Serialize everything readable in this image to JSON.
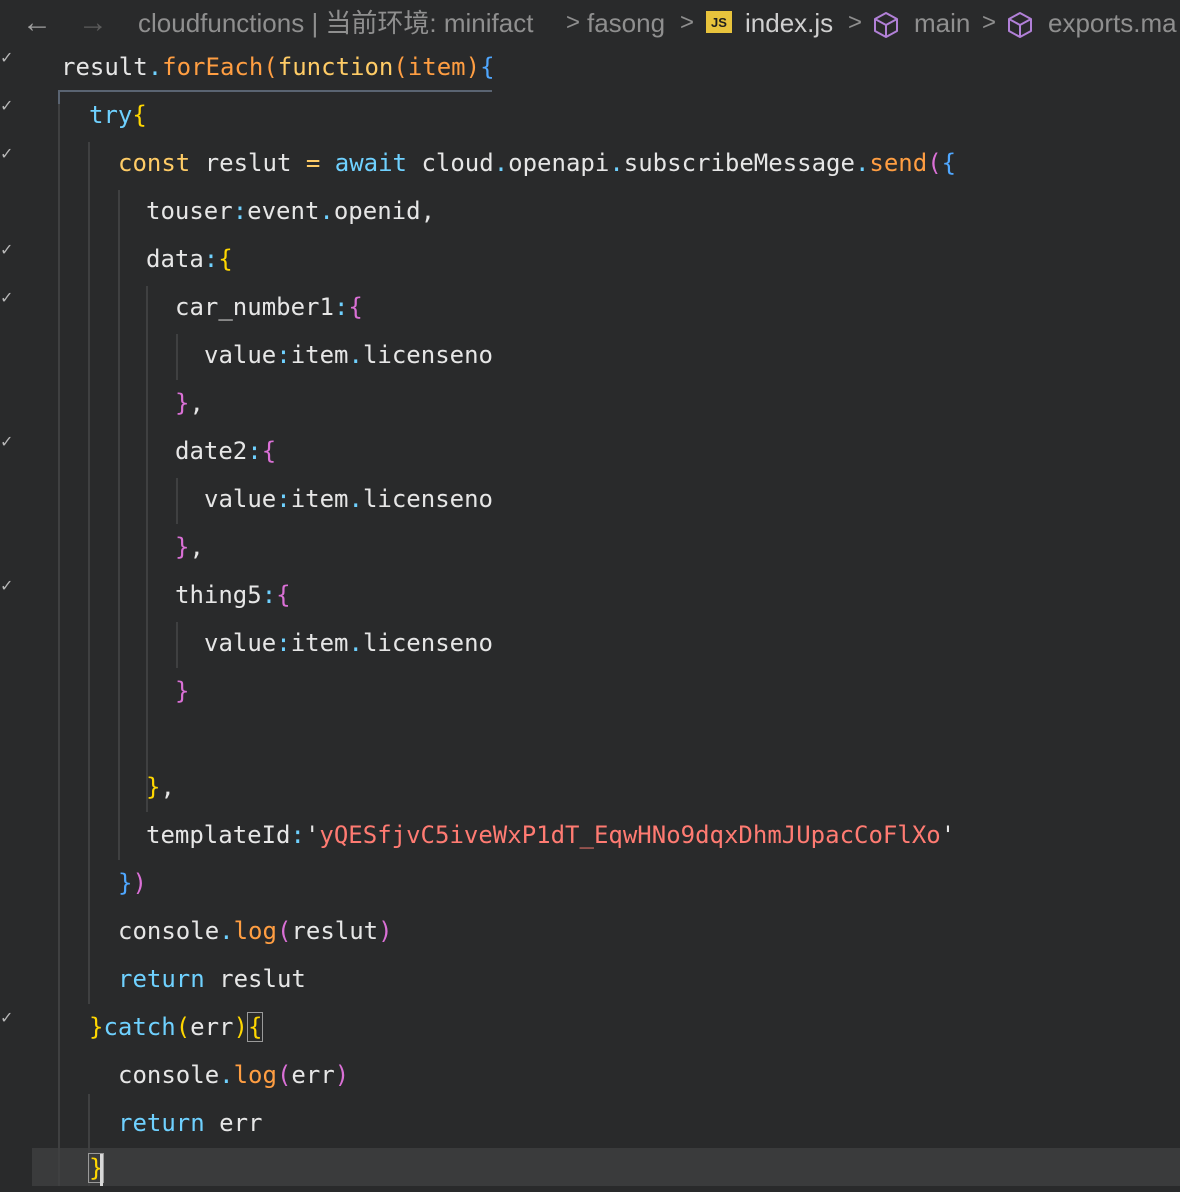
{
  "breadcrumb": {
    "back_icon": "arrow-left-icon",
    "forward_icon": "arrow-right-icon",
    "folder": "cloudfunctions | 当前环境: minifact",
    "subfolder": "fasong",
    "file_badge": "JS",
    "file": "index.js",
    "symbol1": "main",
    "symbol2": "exports.ma",
    "separator": ">"
  },
  "code": {
    "l1": [
      "result",
      ".",
      "forEach",
      "(",
      "function",
      "(",
      "item",
      ")",
      "{"
    ],
    "l2": [
      "try",
      "{"
    ],
    "l3": [
      "const",
      " reslut ",
      "=",
      " await",
      " cloud",
      ".",
      "openapi",
      ".",
      "subscribeMessage",
      ".",
      "send",
      "(",
      "{"
    ],
    "l4": [
      "touser",
      ":",
      "event",
      ".",
      "openid",
      ","
    ],
    "l5": [
      "data",
      ":",
      "{"
    ],
    "l6": [
      "car_number1",
      ":",
      "{"
    ],
    "l7": [
      "value",
      ":",
      "item",
      ".",
      "licenseno"
    ],
    "l8": [
      "}",
      ","
    ],
    "l9": [
      "date2",
      ":",
      "{"
    ],
    "l10": [
      "value",
      ":",
      "item",
      ".",
      "licenseno"
    ],
    "l11": [
      "}",
      ","
    ],
    "l12": [
      "thing5",
      ":",
      "{"
    ],
    "l13": [
      "value",
      ":",
      "item",
      ".",
      "licenseno"
    ],
    "l14": [
      "}"
    ],
    "l16": [
      "}",
      ","
    ],
    "l17": [
      "templateId",
      ":",
      "'",
      "yQESfjvC5iveWxP1dT_EqwHNo9dqxDhmJUpacCoFlXo",
      "'"
    ],
    "l18": [
      "}",
      ")"
    ],
    "l19": [
      "console",
      ".",
      "log",
      "(",
      "reslut",
      ")"
    ],
    "l20": [
      "return",
      " reslut"
    ],
    "l21": [
      "}",
      "catch",
      "(",
      "err",
      ")",
      "{"
    ],
    "l22": [
      "console",
      ".",
      "log",
      "(",
      "err",
      ")"
    ],
    "l23": [
      "return",
      " err"
    ],
    "l24": [
      "}"
    ]
  },
  "gutter": {
    "fold_icon": "✓"
  }
}
